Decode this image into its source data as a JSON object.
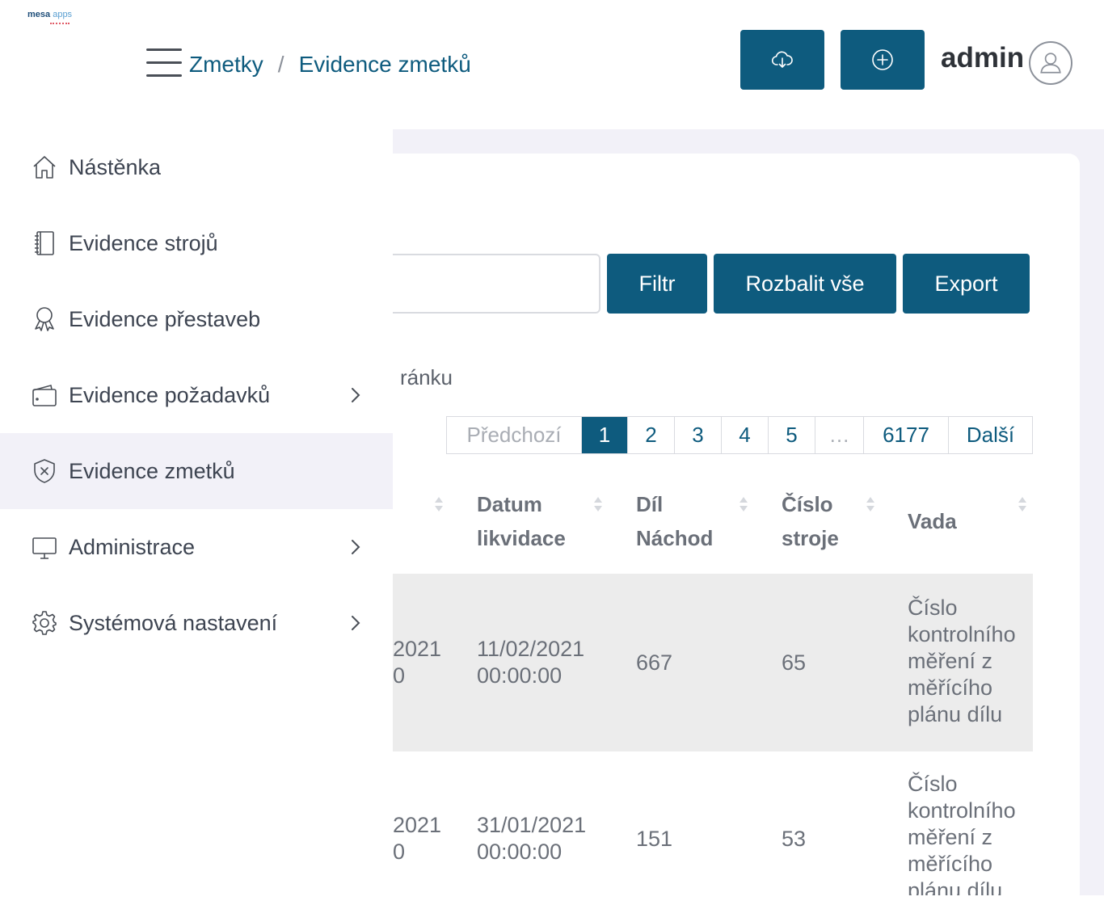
{
  "logo": {
    "bold": "mesa",
    "light": "apps"
  },
  "breadcrumb": {
    "section": "Zmetky",
    "separator": "/",
    "page": "Evidence zmetků"
  },
  "header": {
    "user": "admin"
  },
  "toolbar": {
    "filter": "Filtr",
    "expand_all": "Rozbalit vše",
    "export": "Export"
  },
  "perpage_text": "ránku",
  "pagination": {
    "prev": "Předchozí",
    "pages": [
      "1",
      "2",
      "3",
      "4",
      "5"
    ],
    "ellipsis": "…",
    "last": "6177",
    "next": "Další",
    "current": "1"
  },
  "table": {
    "columns": [
      {
        "l1": "Datum",
        "l2": "likvidace"
      },
      {
        "l1": "Díl",
        "l2": "Náchod"
      },
      {
        "l1": "Číslo",
        "l2": "stroje"
      },
      {
        "l1": "Vada",
        "l2": ""
      }
    ],
    "rows": [
      {
        "partial1": "2021",
        "partial2": "0",
        "date1": "11/02/2021",
        "date2": "00:00:00",
        "dil": "667",
        "stroj": "65",
        "vada": [
          "Číslo",
          "kontrolního",
          "měření z",
          "měřícího",
          "plánu dílu"
        ]
      },
      {
        "partial1": "2021",
        "partial2": "0",
        "date1": "31/01/2021",
        "date2": "00:00:00",
        "dil": "151",
        "stroj": "53",
        "vada": [
          "Číslo",
          "kontrolního",
          "měření z",
          "měřícího",
          "plánu dílu"
        ]
      }
    ]
  },
  "sidebar": {
    "items": [
      {
        "label": "Nástěnka",
        "icon": "home-icon"
      },
      {
        "label": "Evidence strojů",
        "icon": "notebook-icon"
      },
      {
        "label": "Evidence přestaveb",
        "icon": "award-icon"
      },
      {
        "label": "Evidence požadavků",
        "icon": "wallet-icon"
      },
      {
        "label": "Evidence zmetků",
        "icon": "shield-x-icon"
      },
      {
        "label": "Administrace",
        "icon": "monitor-icon"
      },
      {
        "label": "Systémová nastavení",
        "icon": "gear-icon"
      }
    ]
  },
  "colors": {
    "primary": "#0e5b7e",
    "active_bg": "#f2f1f8",
    "row_bg": "#ececec"
  }
}
